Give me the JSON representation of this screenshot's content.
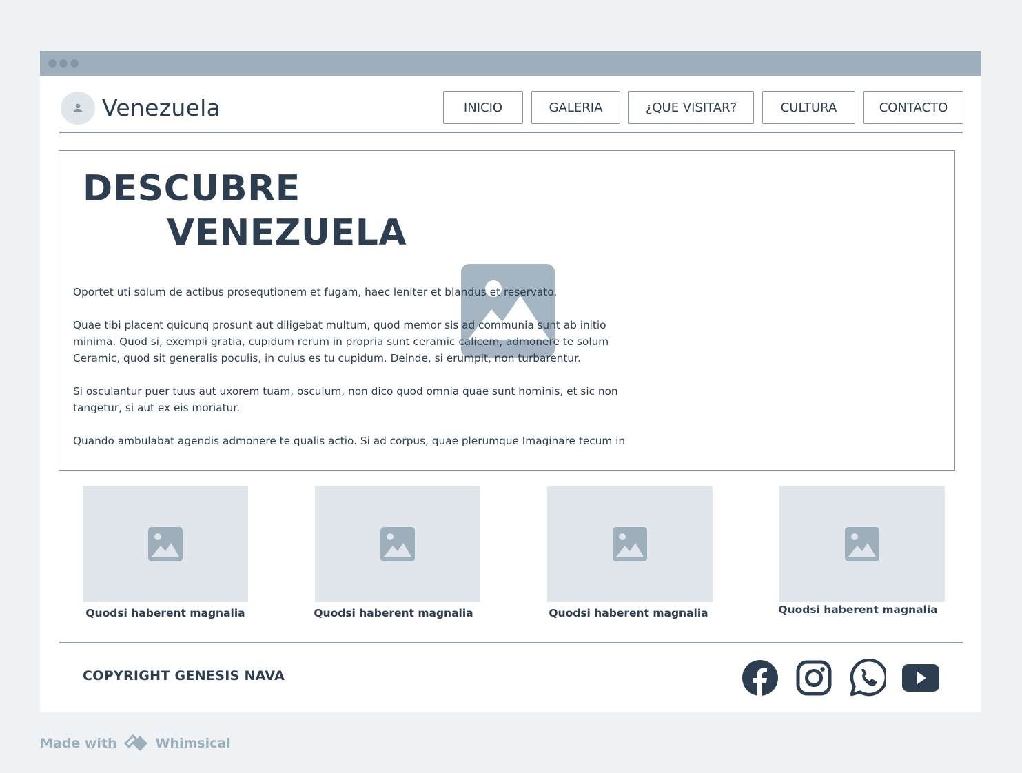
{
  "site": {
    "title": "Venezuela"
  },
  "nav": {
    "items": [
      {
        "label": "INICIO"
      },
      {
        "label": "GALERIA"
      },
      {
        "label": "¿QUE VISITAR?"
      },
      {
        "label": "CULTURA"
      },
      {
        "label": "CONTACTO"
      }
    ]
  },
  "hero": {
    "title_line1": "DESCUBRE",
    "title_line2": "VENEZUELA",
    "paragraphs": [
      [
        "Oportet uti solum de actibus prosequtionem et fugam, haec leniter et blandus et reservato."
      ],
      [
        "Quae tibi placent quicunq prosunt aut diligebat multum, quod memor sis ad communia sunt ab initio",
        "minima. Quod si, exempli gratia, cupidum rerum in propria sunt ceramic calicem, admonere te solum",
        "Ceramic, quod sit generalis poculis, in cuius es tu cupidum. Deinde, si erumpit, non turbarentur."
      ],
      [
        "Si osculantur puer tuus aut uxorem tuam, osculum, non dico quod omnia quae sunt hominis, et sic non",
        "tangetur, si aut ex eis moriatur."
      ],
      [
        "Quando ambulabat agendis admonere te qualis actio. Si ad corpus, quae plerumque Imaginare tecum in"
      ]
    ],
    "image_icon": "image-placeholder-icon"
  },
  "gallery": {
    "cards": [
      {
        "caption": "Quodsi haberent magnalia"
      },
      {
        "caption": "Quodsi haberent magnalia"
      },
      {
        "caption": "Quodsi haberent magnalia"
      },
      {
        "caption": "Quodsi haberent magnalia"
      }
    ]
  },
  "footer": {
    "copyright": "COPYRIGHT GENESIS NAVA",
    "social": [
      "facebook-icon",
      "instagram-icon",
      "whatsapp-icon",
      "youtube-icon"
    ]
  },
  "watermark": {
    "made_with": "Made with",
    "brand": "Whimsical"
  },
  "colors": {
    "background": "#eff2f5",
    "titlebar": "#9eafbc",
    "text": "#2c3e50",
    "border": "#8796a3",
    "placeholder": "#e1e5ec"
  }
}
